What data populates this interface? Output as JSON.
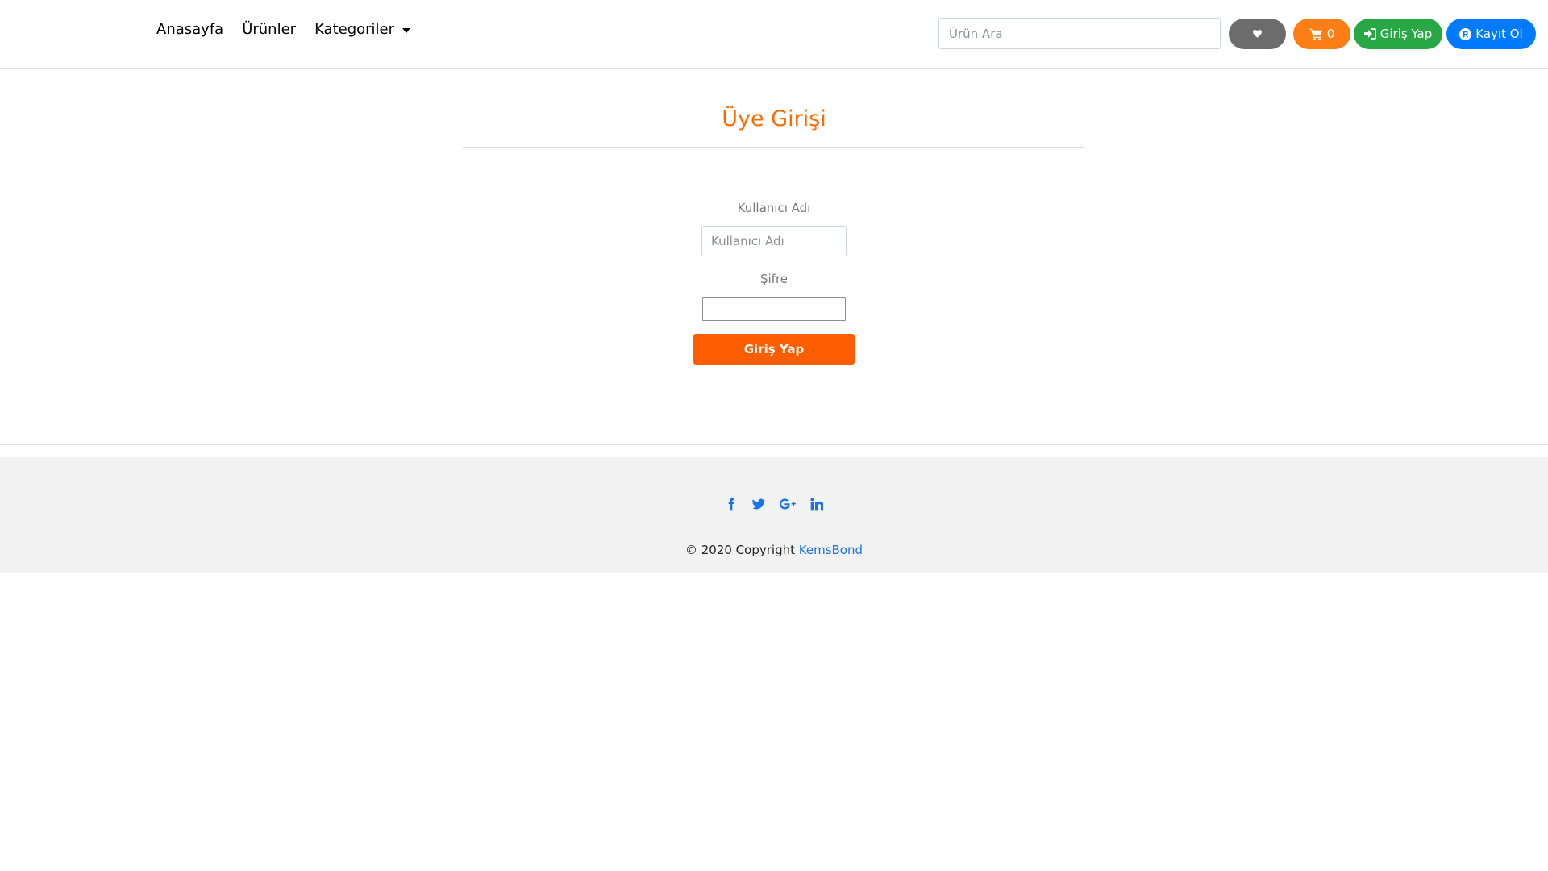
{
  "nav": {
    "links": [
      "Anasayfa",
      "Ürünler"
    ],
    "dropdown_label": "Kategoriler"
  },
  "search": {
    "placeholder": "Ürün Ara"
  },
  "actions": {
    "cart_count": "0",
    "login_label": "Giriş Yap",
    "register_label": "Kayıt Ol"
  },
  "login": {
    "title": "Üye Girişi",
    "username_label": "Kullanıcı Adı",
    "username_placeholder": "Kullanıcı Adı",
    "password_label": "Şifre",
    "submit_label": "Giriş Yap"
  },
  "footer": {
    "copyright_prefix": "© 2020 Copyright",
    "copyright_link": "KemsBond",
    "social_icons": [
      "facebook-icon",
      "twitter-icon",
      "google-plus-icon",
      "linkedin-icon"
    ]
  },
  "colors": {
    "accent_orange": "#ff6a00",
    "favorites_bg": "#6c6c6c",
    "cart_bg": "#fd7e14",
    "login_bg": "#28a745",
    "register_bg": "#007bff",
    "social_blue": "#1a73e8"
  }
}
